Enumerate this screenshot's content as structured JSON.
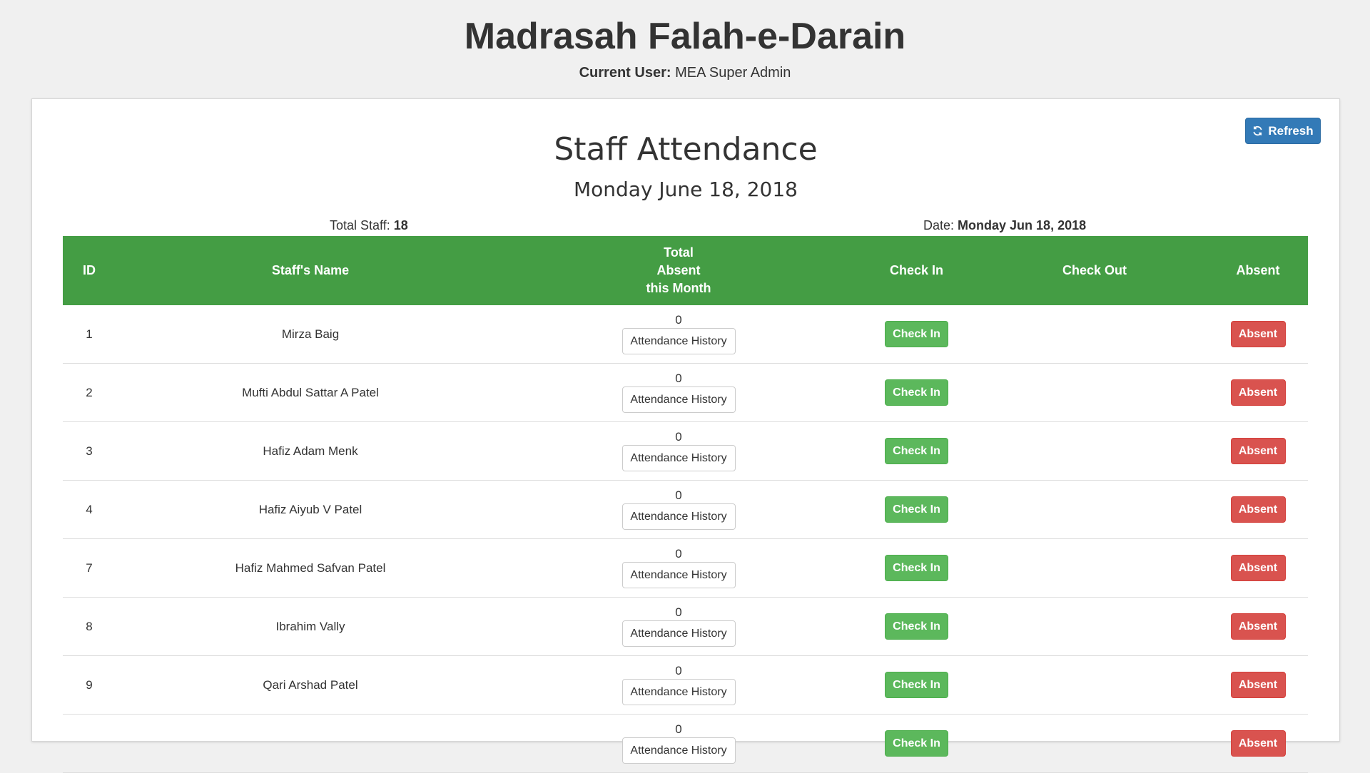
{
  "header": {
    "school_name": "Madrasah Falah-e-Darain",
    "current_user_label": "Current User:",
    "current_user": "MEA Super Admin"
  },
  "toolbar": {
    "refresh_label": "Refresh",
    "refresh_icon": "refresh-icon"
  },
  "page": {
    "title": "Staff Attendance",
    "date_heading": "Monday June 18, 2018"
  },
  "stats": {
    "total_staff_label": "Total Staff:",
    "total_staff": "18",
    "date_label": "Date:",
    "date_value": "Monday Jun 18, 2018"
  },
  "table": {
    "headers": {
      "id": "ID",
      "name": "Staff's Name",
      "absent_line1": "Total",
      "absent_line2": "Absent",
      "absent_line3": "this Month",
      "check_in": "Check In",
      "check_out": "Check Out",
      "absent": "Absent"
    },
    "check_in_label": "Check In",
    "absent_label": "Absent",
    "history_label": "Attendance History",
    "rows": [
      {
        "id": "1",
        "name": "Mirza Baig",
        "absent_count": "0"
      },
      {
        "id": "2",
        "name": "Mufti Abdul Sattar A Patel",
        "absent_count": "0"
      },
      {
        "id": "3",
        "name": "Hafiz Adam Menk",
        "absent_count": "0"
      },
      {
        "id": "4",
        "name": "Hafiz Aiyub V Patel",
        "absent_count": "0"
      },
      {
        "id": "7",
        "name": "Hafiz Mahmed Safvan Patel",
        "absent_count": "0"
      },
      {
        "id": "8",
        "name": "Ibrahim Vally",
        "absent_count": "0"
      },
      {
        "id": "9",
        "name": "Qari Arshad Patel",
        "absent_count": "0"
      },
      {
        "id": "",
        "name": "",
        "absent_count": "0"
      }
    ]
  },
  "colors": {
    "header_green": "#449d44",
    "check_in_green": "#5cb85c",
    "absent_red": "#d9534f",
    "refresh_blue": "#337ab7"
  }
}
